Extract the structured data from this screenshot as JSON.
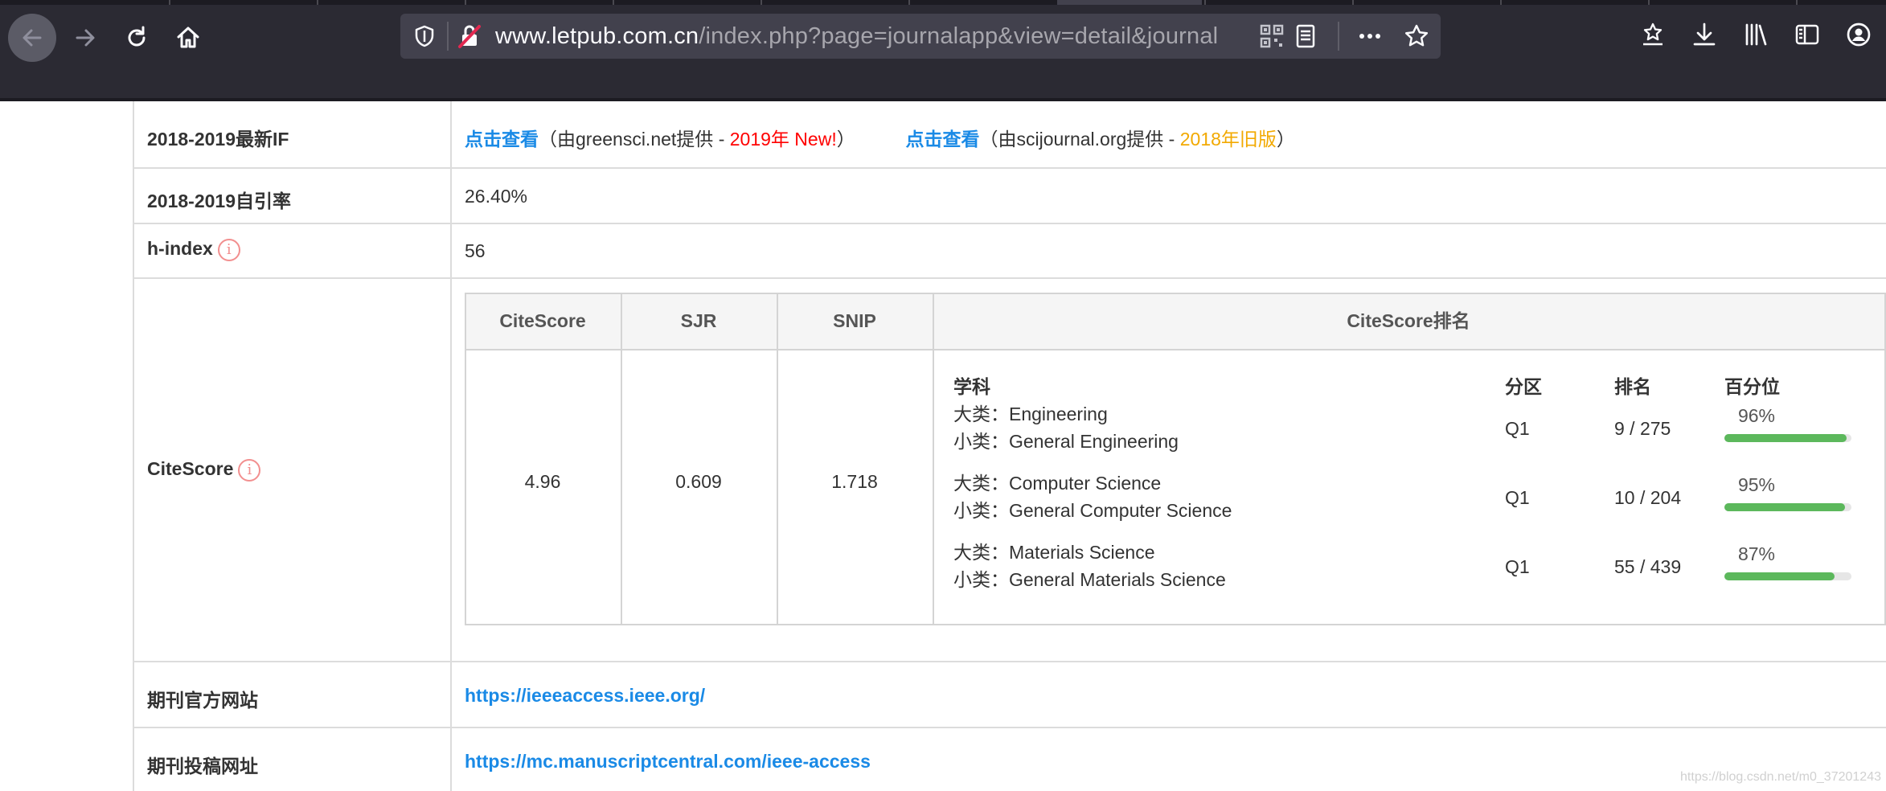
{
  "browser": {
    "url_host": "www.letpub.com.cn",
    "url_path": "/index.php?page=journalapp&view=detail&journal"
  },
  "rows": {
    "if": {
      "label": "2018-2019最新IF",
      "link1": "点击查看",
      "src1_a": "（由greensci.net提供 - ",
      "src1_tag": "2019年 New!",
      "src1_b": "）",
      "link2": "点击查看",
      "src2_a": "（由scijournal.org提供 - ",
      "src2_tag": "2018年旧版",
      "src2_b": "）"
    },
    "selfcite": {
      "label": "2018-2019自引率",
      "value": "26.40%"
    },
    "hindex": {
      "label": "h-index",
      "value": "56"
    },
    "citescore": {
      "label": "CiteScore"
    },
    "website": {
      "label": "期刊官方网站",
      "value": "https://ieeeaccess.ieee.org/"
    },
    "submit": {
      "label": "期刊投稿网址",
      "value": "https://mc.manuscriptcentral.com/ieee-access"
    }
  },
  "citescore_table": {
    "headers": [
      "CiteScore",
      "SJR",
      "SNIP",
      "CiteScore排名"
    ],
    "citescore": "4.96",
    "sjr": "0.609",
    "snip": "1.718",
    "rank_headers": {
      "subject": "学科",
      "quartile": "分区",
      "rank": "排名",
      "percentile": "百分位"
    },
    "rankings": [
      {
        "major": "大类：Engineering",
        "minor": "小类：General Engineering",
        "quartile": "Q1",
        "rank": "9 / 275",
        "percentile_label": "96%",
        "percentile": 96
      },
      {
        "major": "大类：Computer Science",
        "minor": "小类：General Computer Science",
        "quartile": "Q1",
        "rank": "10 / 204",
        "percentile_label": "95%",
        "percentile": 95
      },
      {
        "major": "大类：Materials Science",
        "minor": "小类：General Materials Science",
        "quartile": "Q1",
        "rank": "55 / 439",
        "percentile_label": "87%",
        "percentile": 87
      }
    ]
  },
  "watermark": "https://blog.csdn.net/m0_37201243",
  "colors": {
    "link": "#1a8ae6",
    "new_tag": "#ff0000",
    "old_tag": "#f2a900",
    "bar": "#5cb85c"
  }
}
